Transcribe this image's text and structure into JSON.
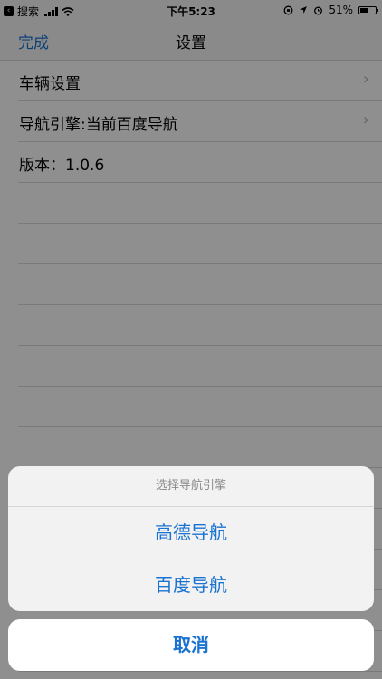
{
  "status_bar": {
    "back_app": "搜索",
    "time": "下午5:23",
    "battery": "51%",
    "battery_level": 0.51
  },
  "nav": {
    "done": "完成",
    "title": "设置"
  },
  "settings": {
    "rows": [
      {
        "label": "车辆设置"
      },
      {
        "label": "导航引擎:当前百度导航"
      },
      {
        "label": "版本：1.0.6"
      }
    ]
  },
  "action_sheet": {
    "title": "选择导航引擎",
    "options": [
      "高德导航",
      "百度导航"
    ],
    "cancel": "取消"
  },
  "colors": {
    "accent": "#1a73d1"
  }
}
